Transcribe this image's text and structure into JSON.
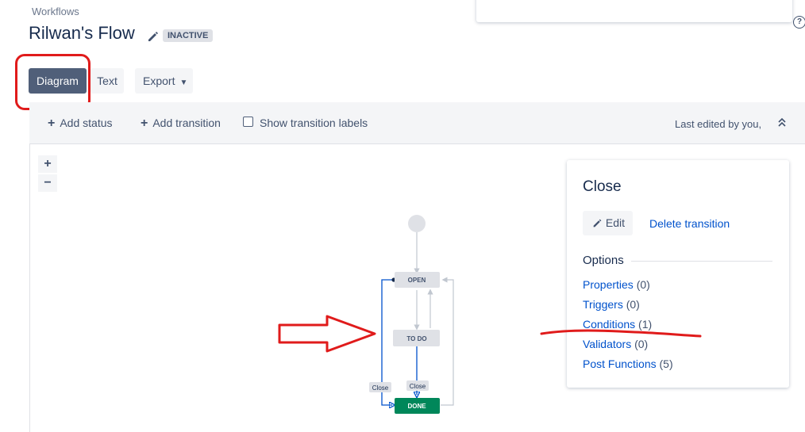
{
  "header": {
    "breadcrumb": "Workflows",
    "title": "Rilwan's Flow",
    "status": "INACTIVE"
  },
  "views": {
    "diagram": "Diagram",
    "text": "Text",
    "export": "Export"
  },
  "toolbar": {
    "add_status": "Add status",
    "add_transition": "Add transition",
    "show_labels": "Show transition labels",
    "show_labels_checked": false,
    "last_edited": "Last edited by you,"
  },
  "zoom": {
    "in": "+",
    "out": "−"
  },
  "diagram": {
    "statuses": [
      "OPEN",
      "TO DO",
      "DONE"
    ],
    "transition_labels": [
      "Close",
      "Close"
    ]
  },
  "panel": {
    "title": "Close",
    "edit_label": "Edit",
    "delete_label": "Delete transition",
    "options_heading": "Options",
    "options": [
      {
        "label": "Properties",
        "count": "(0)"
      },
      {
        "label": "Triggers",
        "count": "(0)"
      },
      {
        "label": "Conditions",
        "count": "(1)"
      },
      {
        "label": "Validators",
        "count": "(0)"
      },
      {
        "label": "Post Functions",
        "count": "(5)"
      }
    ]
  },
  "colors": {
    "primary_button": "#505f79",
    "link": "#0052cc",
    "done_status": "#00875a",
    "annotation_red": "#e01b1b"
  }
}
